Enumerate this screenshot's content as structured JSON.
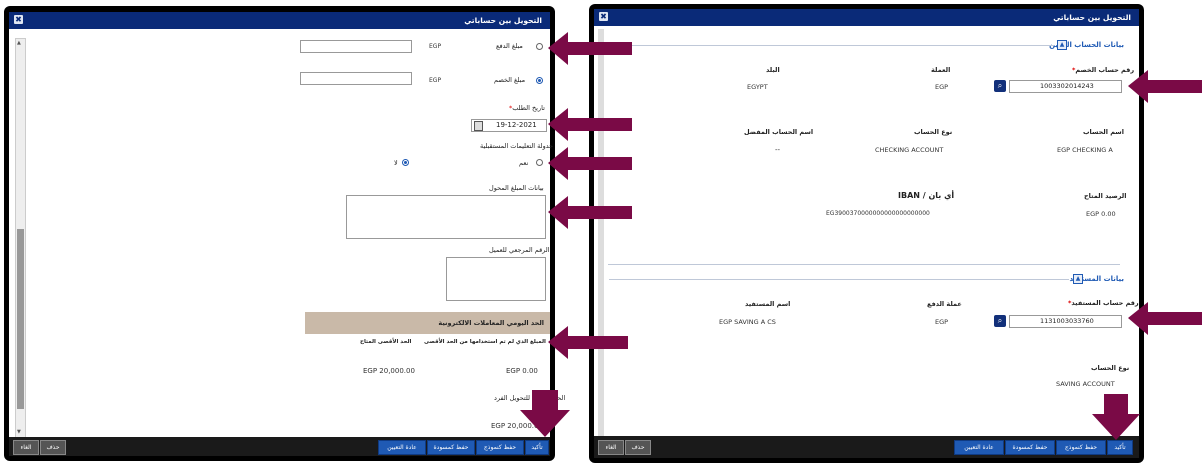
{
  "left_window": {
    "title": "التحويل بين حساباتي",
    "close_icon": "close-icon",
    "radio_option_1_label": "مبلغ الدفع",
    "radio_option_1_currency": "EGP",
    "radio_option_2_label": "مبلغ الخصم",
    "radio_option_2_currency": "EGP",
    "request_date_label": "تاريخ الطلب",
    "request_date_value": "19-12-2021",
    "future_schedule_label": "جدولة التعليمات المستقبلية",
    "yes_label": "نعم",
    "no_label": "لا",
    "transfer_details_label": "بيانات المبلغ المحول",
    "customer_ref_label": "الرقم المرجعي للعميل",
    "daily_limit_header": "الحد اليومي المعاملات الالكترونية",
    "unused_limit_label": "الحد الأقصى المتاح",
    "remaining_label": "المبلغ الذي لم تم استخدامها من الحد الأقصى",
    "available_max_value": "EGP 20,000.00",
    "unused_value": "EGP 0.00",
    "single_max_label": "الحد الأقصى للتحويل الفرد",
    "single_max_value": "EGP 20,000.00",
    "buttons": {
      "confirm": "تأكيد",
      "save_template": "حفظ كنموذج",
      "save_draft": "حفظ كمسودة",
      "reset": "عادة التعيين",
      "delete": "حذف",
      "cancel": "الغاء"
    }
  },
  "right_window": {
    "title": "التحويل بين حساباتي",
    "debit_section_title": "بيانات الحساب المدين",
    "debit_account_label": "رقم حساب الخصم",
    "debit_account_value": "1003302014243",
    "currency_label": "العملة",
    "currency_value": "EGP",
    "country_label": "البلد",
    "country_value": "EGYPT",
    "account_name_label": "اسم الحساب",
    "account_name_value": "EGP CHECKING A",
    "account_type_label": "نوع الحساب",
    "account_type_value": "CHECKING ACCOUNT",
    "preferred_name_label": "اسم الحساب المفضل",
    "preferred_name_value": "--",
    "available_balance_label": "الرصيد المتاح",
    "available_balance_value": "EGP 0.00",
    "iban_label": "IBAN / أي بان",
    "iban_value": "EG3900370000000000000000000",
    "beneficiary_section_title": "بيانات المستفيد",
    "beneficiary_account_label": "رقم حساب المستفيد",
    "beneficiary_account_value": "1131003033760",
    "payment_currency_label": "عملة الدفع",
    "payment_currency_value": "EGP",
    "beneficiary_name_label": "اسم المستفيد",
    "beneficiary_name_value": "EGP SAVING A CS",
    "beneficiary_account_type_label": "نوع الحساب",
    "beneficiary_account_type_value": "SAVING ACCOUNT",
    "buttons": {
      "confirm": "تأكيد",
      "save_template": "حفظ كنموذج",
      "save_draft": "حفظ كمسودة",
      "reset": "عادة التعيين",
      "delete": "حذف",
      "cancel": "الغاء"
    }
  },
  "colors": {
    "titlebar": "#0a2a78",
    "arrow": "#7a0a46",
    "button_blue": "#1f5ab4",
    "limit_header_bg": "#c9b9a8"
  }
}
